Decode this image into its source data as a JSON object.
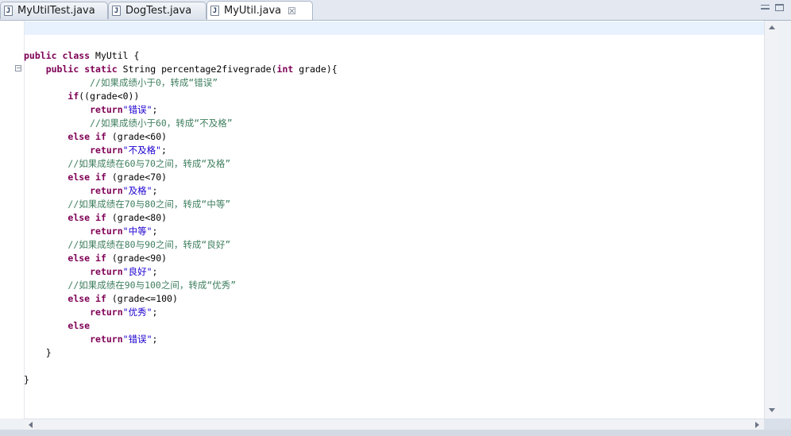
{
  "tabs": [
    {
      "label": "MyUtilTest.java",
      "icon": "java-file-icon",
      "active": false
    },
    {
      "label": "DogTest.java",
      "icon": "java-file-icon",
      "active": false
    },
    {
      "label": "MyUtil.java",
      "icon": "java-file-icon",
      "active": true,
      "close": "☒"
    }
  ],
  "tab_icon_glyph": "J",
  "fold_glyph": "−",
  "code": {
    "l1": {
      "a": "public",
      "b": " ",
      "c": "class",
      "d": " MyUtil {"
    },
    "l2": {
      "indent": "    ",
      "a": "public",
      "b": " ",
      "c": "static",
      "d": " String percentage2fivegrade(",
      "e": "int",
      "f": " grade){"
    },
    "l3": {
      "indent": "            ",
      "cm": "//如果成绩小于0，转成“错误”"
    },
    "l4": {
      "indent": "        ",
      "a": "if",
      "b": "((grade<0))"
    },
    "l5": {
      "indent": "            ",
      "a": "return",
      "s": "\"错误\"",
      "e": ";"
    },
    "l6": {
      "indent": "            ",
      "cm": "//如果成绩小于60，转成“不及格”"
    },
    "l7": {
      "indent": "        ",
      "a": "else",
      "b": " ",
      "c": "if",
      "d": " (grade<60)"
    },
    "l8": {
      "indent": "            ",
      "a": "return",
      "s": "\"不及格\"",
      "e": ";"
    },
    "l9": {
      "indent": "        ",
      "cm": "//如果成绩在60与70之间，转成“及格”"
    },
    "l10": {
      "indent": "        ",
      "a": "else",
      "b": " ",
      "c": "if",
      "d": " (grade<70)"
    },
    "l11": {
      "indent": "            ",
      "a": "return",
      "s": "\"及格\"",
      "e": ";"
    },
    "l12": {
      "indent": "        ",
      "cm": "//如果成绩在70与80之间，转成“中等”"
    },
    "l13": {
      "indent": "        ",
      "a": "else",
      "b": " ",
      "c": "if",
      "d": " (grade<80)"
    },
    "l14": {
      "indent": "            ",
      "a": "return",
      "s": "\"中等\"",
      "e": ";"
    },
    "l15": {
      "indent": "        ",
      "cm": "//如果成绩在80与90之间，转成“良好”"
    },
    "l16": {
      "indent": "        ",
      "a": "else",
      "b": " ",
      "c": "if",
      "d": " (grade<90)"
    },
    "l17": {
      "indent": "            ",
      "a": "return",
      "s": "\"良好\"",
      "e": ";"
    },
    "l18": {
      "indent": "        ",
      "cm": "//如果成绩在90与100之间，转成“优秀”"
    },
    "l19": {
      "indent": "        ",
      "a": "else",
      "b": " ",
      "c": "if",
      "d": " (grade<=100)"
    },
    "l20": {
      "indent": "            ",
      "a": "return",
      "s": "\"优秀\"",
      "e": ";"
    },
    "l21": {
      "indent": "        ",
      "a": "else"
    },
    "l22": {
      "indent": "            ",
      "a": "return",
      "s": "\"错误\"",
      "e": ";"
    },
    "l23": {
      "indent": "    ",
      "d": "}"
    },
    "l24": {
      "d": ""
    },
    "l25": {
      "d": "}"
    }
  },
  "colors": {
    "keyword": "#7f0055",
    "comment": "#3f7f5f",
    "string": "#1c00cf",
    "current_line": "#e8f2fe"
  }
}
